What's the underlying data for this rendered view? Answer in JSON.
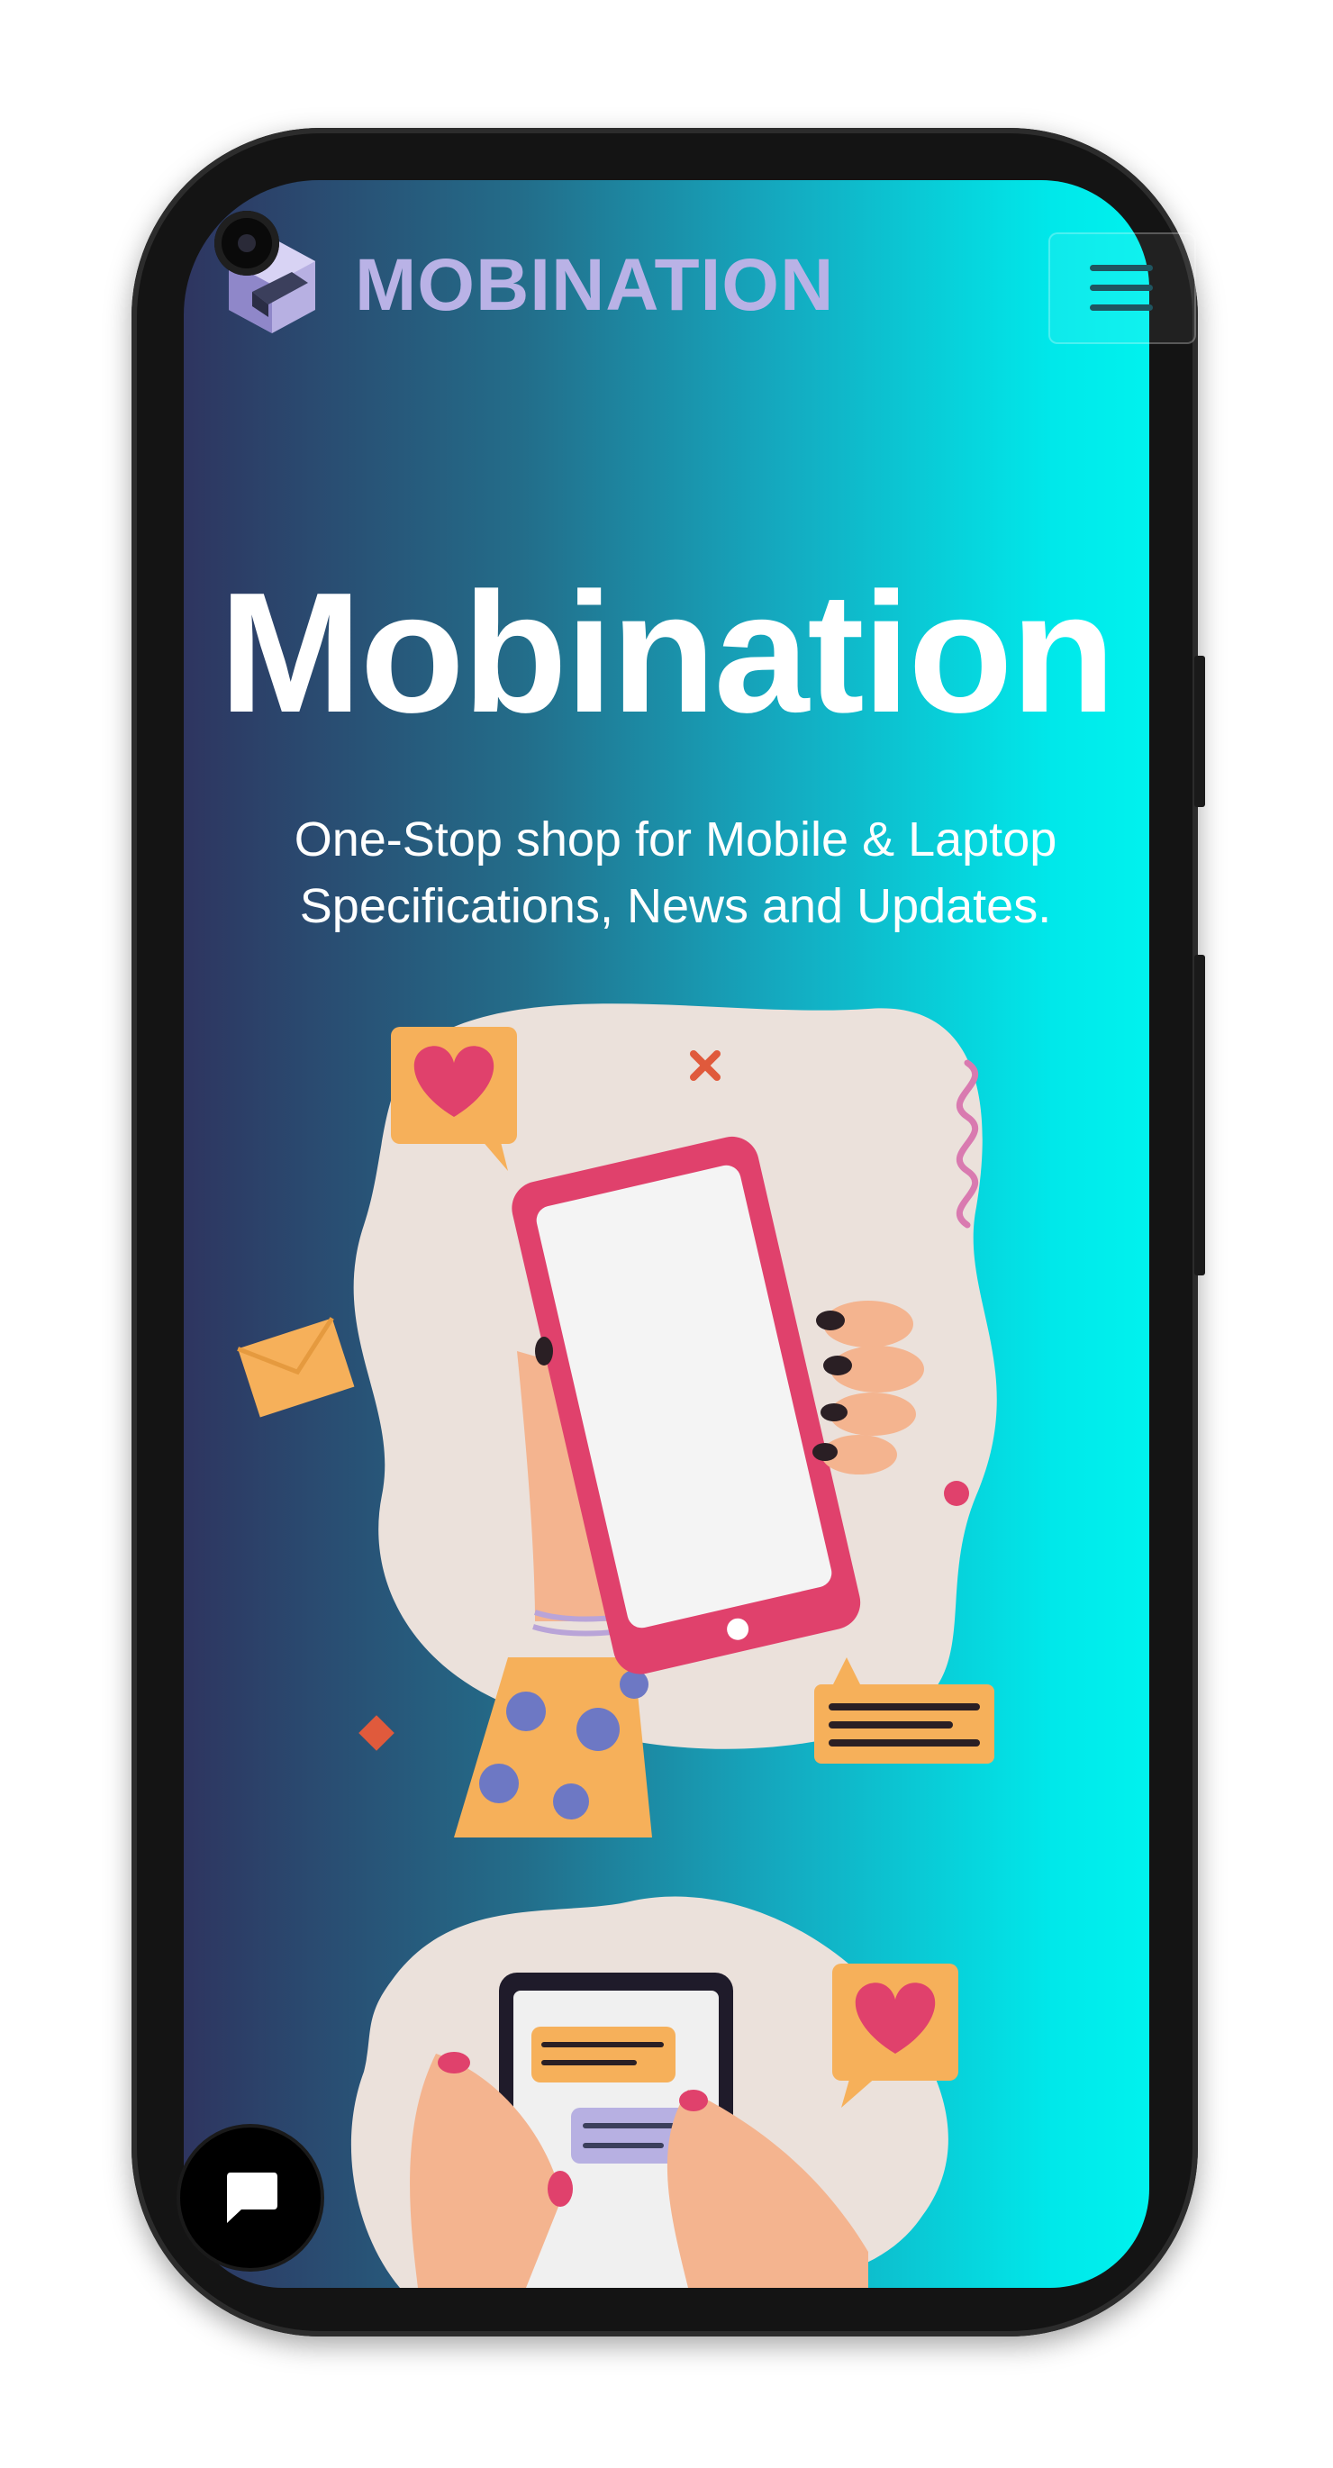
{
  "app": {
    "brand_name": "MOBINATION",
    "logo_icon": "cube-icon"
  },
  "header": {
    "menu_icon": "hamburger-menu-icon"
  },
  "hero": {
    "title": "Mobination",
    "subtitle_line1": "One-Stop shop for Mobile & Laptop",
    "subtitle_line2": "Specifications, News and Updates."
  },
  "illustration": {
    "description_icons": [
      "heart-icon",
      "envelope-icon",
      "chat-bubble-icon",
      "smartphone-icon",
      "tablet-icon"
    ]
  },
  "chat": {
    "icon": "chat-icon"
  },
  "colors": {
    "gradient_start": "#2e3560",
    "gradient_end": "#00f2ee",
    "brand_text": "#b9b2e6",
    "phone_pink": "#e0416c",
    "skin": "#f4b48f",
    "blob": "#ebe1db",
    "accent_orange": "#f6b05a"
  }
}
